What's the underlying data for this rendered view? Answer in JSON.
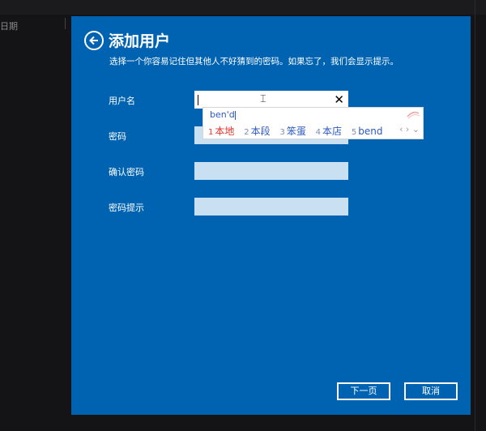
{
  "background": {
    "header_text": "日期"
  },
  "dialog": {
    "title": "添加用户",
    "subtitle": "选择一个你容易记住但其他人不好猜到的密码。如果忘了，我们会显示提示。",
    "fields": [
      {
        "label": "用户名",
        "value": ""
      },
      {
        "label": "密码",
        "value": ""
      },
      {
        "label": "确认密码",
        "value": ""
      },
      {
        "label": "密码提示",
        "value": ""
      }
    ],
    "next_label": "下一页",
    "cancel_label": "取消"
  },
  "ime": {
    "composition": "ben'd",
    "candidates": [
      {
        "num": "1",
        "text": "本地"
      },
      {
        "num": "2",
        "text": "本段"
      },
      {
        "num": "3",
        "text": "笨蛋"
      },
      {
        "num": "4",
        "text": "本店"
      },
      {
        "num": "5",
        "text": "bend"
      }
    ]
  },
  "colors": {
    "dialog_bg": "#0063b1",
    "input_bg": "#c9dff2",
    "candidate_highlight": "#e2342c",
    "candidate_text": "#2c5ac0"
  }
}
